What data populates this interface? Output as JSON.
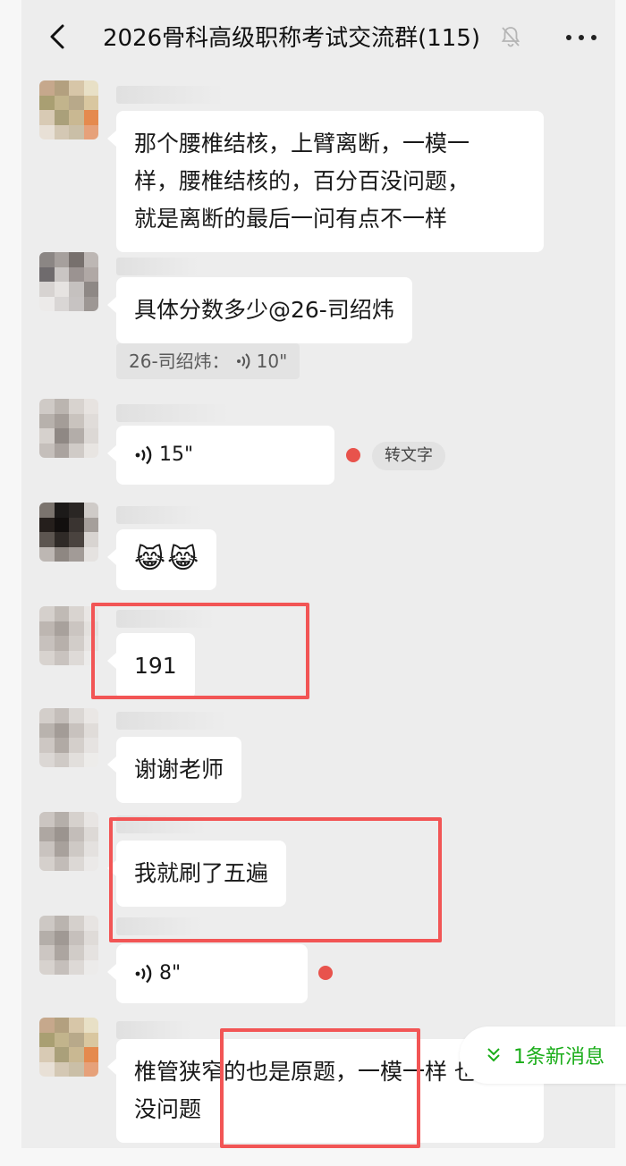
{
  "header": {
    "title": "2026骨科高级职称考试交流群(115)",
    "back_icon": "chevron-left-icon",
    "mute_icon": "bell-off-icon",
    "more_icon": "ellipsis-icon"
  },
  "messages": [
    {
      "type": "text",
      "text_lines": [
        "那个腰椎结核，上臂离断，一模一",
        "样，腰椎结核的，百分百没问题，",
        "就是离断的最后一问有点不一样"
      ]
    },
    {
      "type": "text",
      "text": "具体分数多少@26-司绍炜",
      "quote_sender": "26-司绍炜：",
      "quote_duration": "10\""
    },
    {
      "type": "voice",
      "duration": "15\"",
      "unread": true,
      "transcribe_label": "转文字"
    },
    {
      "type": "emoji",
      "emoji": [
        "😹",
        "😹"
      ]
    },
    {
      "type": "text",
      "text": "191",
      "highlighted": true
    },
    {
      "type": "text",
      "text": "谢谢老师"
    },
    {
      "type": "text",
      "text": "我就刷了五遍",
      "highlighted": true
    },
    {
      "type": "voice",
      "duration": "8\"",
      "unread": true
    },
    {
      "type": "text",
      "text_lines": [
        "椎管狭窄的也是原题，一模一样 也",
        "没问题"
      ],
      "highlighted": true
    }
  ],
  "new_message_pill": {
    "label": "1条新消息",
    "icon": "double-chevron-down-icon"
  },
  "colors": {
    "background": "#ededed",
    "bubble": "#ffffff",
    "highlight_box": "#f25555",
    "accent_green": "#1aad19",
    "unread_dot": "#e8534c"
  }
}
